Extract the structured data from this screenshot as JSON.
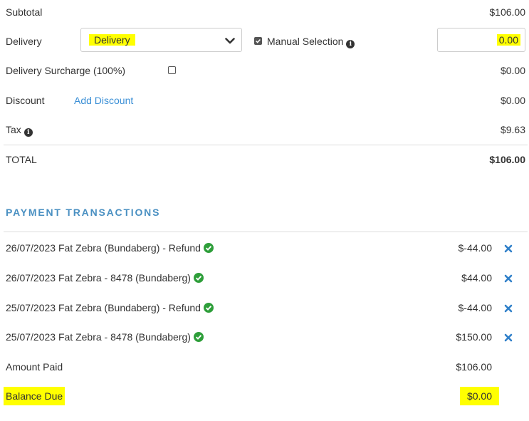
{
  "summary": {
    "subtotal_label": "Subtotal",
    "subtotal_value": "$106.00",
    "delivery_label": "Delivery",
    "delivery_select_value": "Delivery",
    "manual_selection_label": "Manual Selection",
    "manual_selection_checked": true,
    "delivery_amount": "0.00",
    "surcharge_label": "Delivery Surcharge (100%)",
    "surcharge_checked": false,
    "surcharge_value": "$0.00",
    "discount_label": "Discount",
    "add_discount_link": "Add Discount",
    "discount_value": "$0.00",
    "tax_label": "Tax",
    "tax_value": "$9.63",
    "total_label": "TOTAL",
    "total_value": "$106.00"
  },
  "payments": {
    "heading": "PAYMENT TRANSACTIONS",
    "transactions": [
      {
        "description": "26/07/2023 Fat Zebra (Bundaberg) - Refund",
        "amount": "$-44.00"
      },
      {
        "description": "26/07/2023 Fat Zebra - 8478 (Bundaberg)",
        "amount": "$44.00"
      },
      {
        "description": "25/07/2023 Fat Zebra (Bundaberg) - Refund",
        "amount": "$-44.00"
      },
      {
        "description": "25/07/2023 Fat Zebra - 8478 (Bundaberg)",
        "amount": "$150.00"
      }
    ],
    "amount_paid_label": "Amount Paid",
    "amount_paid_value": "$106.00",
    "balance_due_label": "Balance Due",
    "balance_due_value": "$0.00"
  },
  "colors": {
    "highlight": "#ffff00",
    "link": "#3a8fd6",
    "heading": "#4a90c2",
    "success": "#2e9e3a",
    "remove": "#2f7fc9"
  },
  "icons": [
    "info-icon",
    "checkmark-circle-icon",
    "remove-x-icon",
    "chevron-down-icon"
  ]
}
